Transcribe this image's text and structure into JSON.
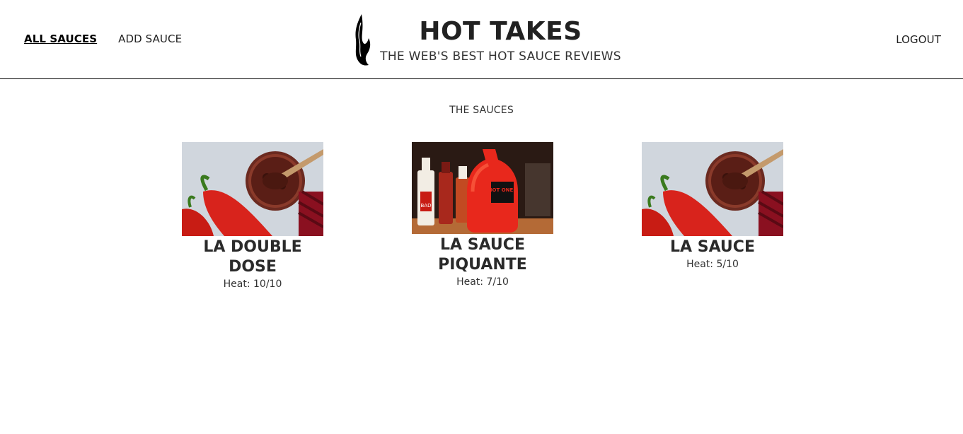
{
  "nav": {
    "all_sauces": "ALL SAUCES",
    "add_sauce": "ADD SAUCE",
    "logout": "LOGOUT"
  },
  "brand": {
    "title": "HOT TAKES",
    "subtitle": "THE WEB'S BEST HOT SAUCE REVIEWS",
    "logo_icon": "flame-icon"
  },
  "main": {
    "section_title": "THE SAUCES",
    "sauces": [
      {
        "name": "LA DOUBLE DOSE",
        "heat": "Heat: 10/10",
        "image": "chili-paste-jar-photo"
      },
      {
        "name": "LA SAUCE PIQUANTE",
        "heat": "Heat: 7/10",
        "image": "hot-ones-bottles-photo",
        "bottle_label": "HOT ONES",
        "small_label": "BAD"
      },
      {
        "name": "LA SAUCE",
        "heat": "Heat: 5/10",
        "image": "chili-paste-jar-photo"
      }
    ]
  },
  "colors": {
    "text": "#212121",
    "pepper_red": "#d8231c",
    "divider": "#000000"
  }
}
